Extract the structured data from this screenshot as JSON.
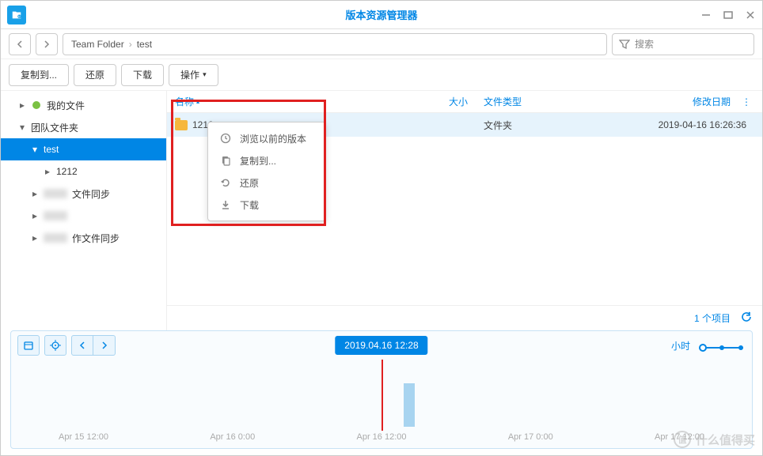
{
  "window": {
    "title": "版本资源管理器"
  },
  "breadcrumb": [
    "Team Folder",
    "test"
  ],
  "search": {
    "placeholder": "搜索"
  },
  "toolbar": {
    "copyTo": "复制到...",
    "restore": "还原",
    "download": "下载",
    "actions": "操作"
  },
  "sidebar": {
    "items": [
      {
        "label": "我的文件",
        "level": 1,
        "expanded": false
      },
      {
        "label": "团队文件夹",
        "level": 1,
        "expanded": true
      },
      {
        "label": "test",
        "level": 2,
        "expanded": true,
        "selected": true
      },
      {
        "label": "1212",
        "level": 3,
        "expanded": false
      },
      {
        "label": "文件同步",
        "level": 2,
        "blurred": true
      },
      {
        "label": "",
        "level": 2,
        "blurred": true
      },
      {
        "label": "作文件同步",
        "level": 2,
        "blurred": true
      }
    ]
  },
  "columns": {
    "name": "名称",
    "size": "大小",
    "type": "文件类型",
    "date": "修改日期"
  },
  "files": [
    {
      "name": "1212",
      "size": "",
      "type": "文件夹",
      "date": "2019-04-16 16:26:36"
    }
  ],
  "status": {
    "count": "1 个项目"
  },
  "contextMenu": {
    "browsePrevious": "浏览以前的版本",
    "copyTo": "复制到...",
    "restore": "还原",
    "download": "下载"
  },
  "timeline": {
    "current": "2019.04.16 12:28",
    "unit": "小时",
    "ticks": [
      "Apr 15 12:00",
      "Apr 16 0:00",
      "Apr 16 12:00",
      "Apr 17 0:00",
      "Apr 17 12:00"
    ]
  },
  "watermark": "什么值得买"
}
